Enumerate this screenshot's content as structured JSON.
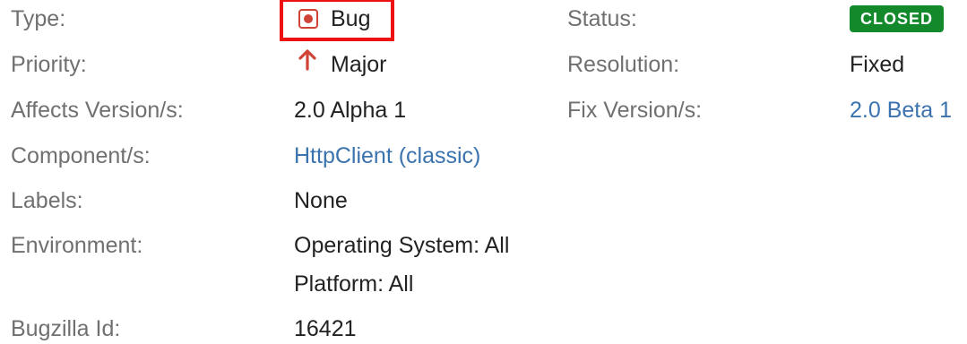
{
  "left_column": {
    "type": {
      "label": "Type:",
      "value": "Bug",
      "icon": "bug-icon"
    },
    "priority": {
      "label": "Priority:",
      "value": "Major",
      "icon": "arrow-up-icon"
    },
    "affects_version": {
      "label": "Affects Version/s:",
      "value": "2.0 Alpha 1"
    },
    "component": {
      "label": "Component/s:",
      "value": "HttpClient (classic)"
    },
    "labels": {
      "label": "Labels:",
      "value": "None"
    },
    "environment": {
      "label": "Environment:",
      "line1": "Operating System: All",
      "line2": "Platform: All"
    },
    "bugzilla": {
      "label": "Bugzilla Id:",
      "value": "16421"
    }
  },
  "right_column": {
    "status": {
      "label": "Status:",
      "value": "CLOSED"
    },
    "resolution": {
      "label": "Resolution:",
      "value": "Fixed"
    },
    "fix_version": {
      "label": "Fix Version/s:",
      "value": "2.0 Beta 1"
    }
  },
  "colors": {
    "label": "#707070",
    "value": "#222222",
    "link": "#3b73af",
    "status_closed": "#14892c",
    "bug_icon": "#d04437",
    "priority_arrow": "#d04437",
    "highlight_box": "#ee1111"
  }
}
